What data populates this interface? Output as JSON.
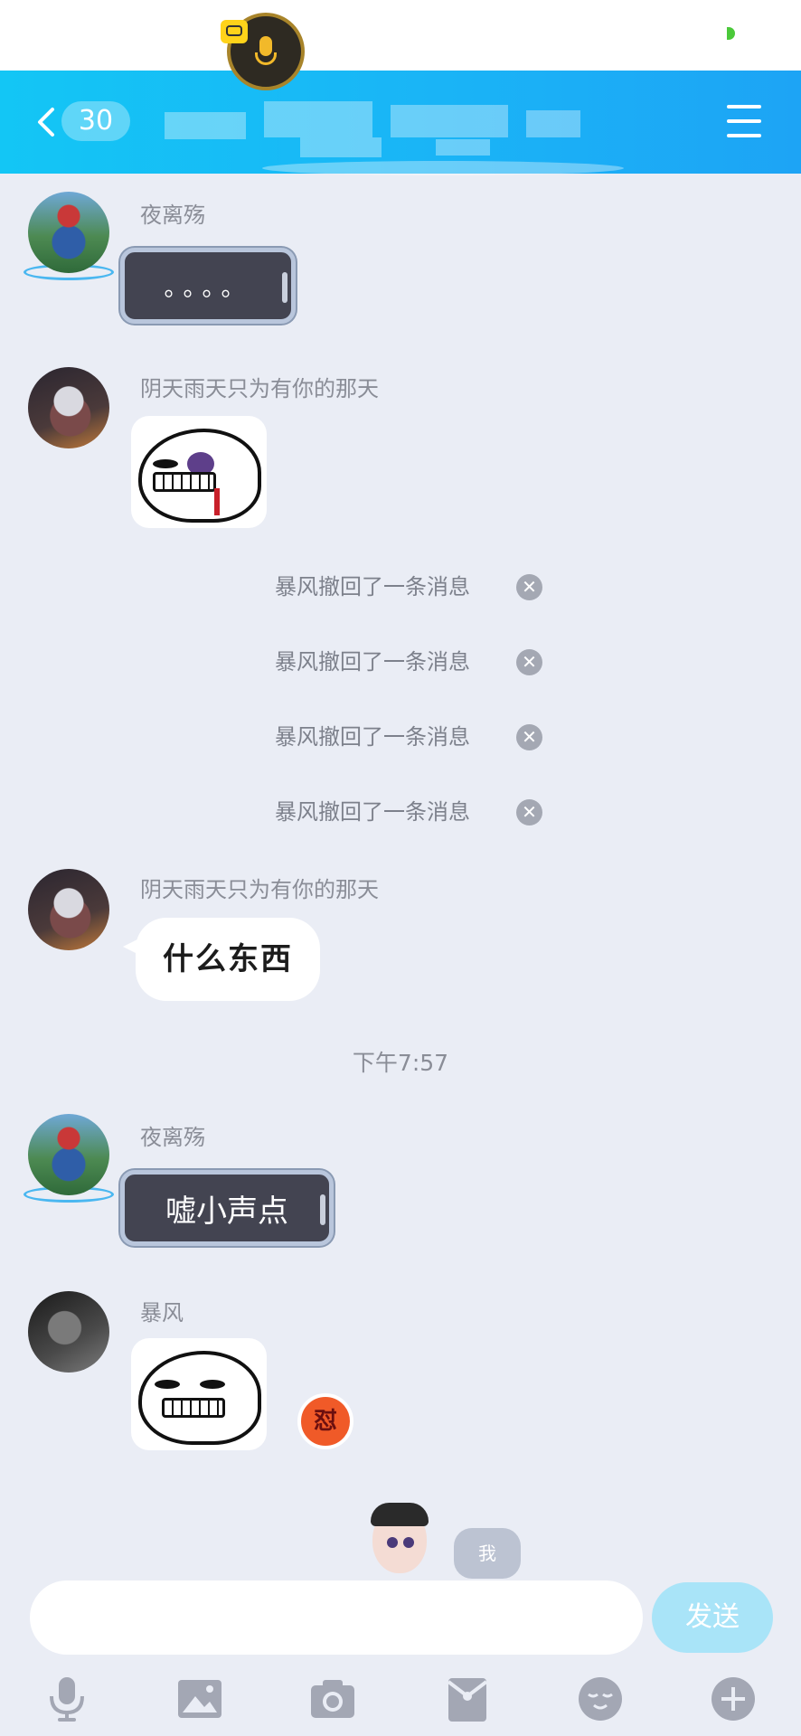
{
  "header": {
    "unread_count": "30"
  },
  "messages": [
    {
      "sender": "夜离殇",
      "text": "。。。。"
    },
    {
      "sender": "阴天雨天只为有你的那天"
    },
    {
      "sender": "阴天雨天只为有你的那天",
      "text": "什么东西"
    },
    {
      "sender": "夜离殇",
      "text": "嘘小声点"
    },
    {
      "sender": "暴风"
    }
  ],
  "recalls": [
    "暴风撤回了一条消息",
    "暴风撤回了一条消息",
    "暴风撤回了一条消息",
    "暴风撤回了一条消息"
  ],
  "time_separator": "下午7:57",
  "reaction_badge": "怼",
  "me_label": "我",
  "composer": {
    "value": "",
    "send_label": "发送"
  },
  "toolbar": {
    "icons": [
      "microphone-icon",
      "image-icon",
      "camera-icon",
      "red-packet-icon",
      "emoji-icon",
      "plus-icon"
    ]
  },
  "colors": {
    "header_gradient_start": "#13c6f5",
    "header_gradient_end": "#1da4f5",
    "background": "#eaedf5",
    "send_button": "#a9e4f8",
    "tool_icon": "#a3a7b4"
  }
}
